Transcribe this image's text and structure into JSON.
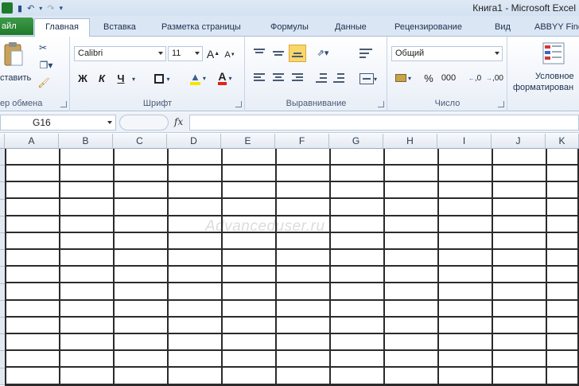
{
  "window": {
    "title": "Книга1 - Microsoft Excel"
  },
  "tabs": [
    "айл",
    "Главная",
    "Вставка",
    "Разметка страницы",
    "Формулы",
    "Данные",
    "Рецензирование",
    "Вид",
    "ABBYY Fine"
  ],
  "ribbon": {
    "clipboard": {
      "paste_label": "ставить",
      "group_label": "ер обмена"
    },
    "font": {
      "font_name": "Calibri",
      "font_size": "11",
      "bold": "Ж",
      "italic": "К",
      "underline": "Ч",
      "grow": "A",
      "shrink": "A",
      "group_label": "Шрифт"
    },
    "alignment": {
      "group_label": "Выравнивание"
    },
    "number": {
      "format": "Общий",
      "percent": "%",
      "thousands": "000",
      "inc_decimal": ",0",
      "dec_decimal": ",00",
      "group_label": "Число"
    },
    "styles": {
      "cond_format_line1": "Условное",
      "cond_format_line2": "форматирован"
    }
  },
  "formula_bar": {
    "cell_ref": "G16",
    "fx": "fx",
    "value": ""
  },
  "sheet": {
    "columns": [
      "A",
      "B",
      "C",
      "D",
      "E",
      "F",
      "G",
      "H",
      "I",
      "J",
      "K"
    ],
    "watermark": "Advanceduser.ru"
  },
  "colors": {
    "file_tab": "#2a8a36",
    "accent": "#dbe6f4",
    "grid_line": "#2b2b2b"
  }
}
